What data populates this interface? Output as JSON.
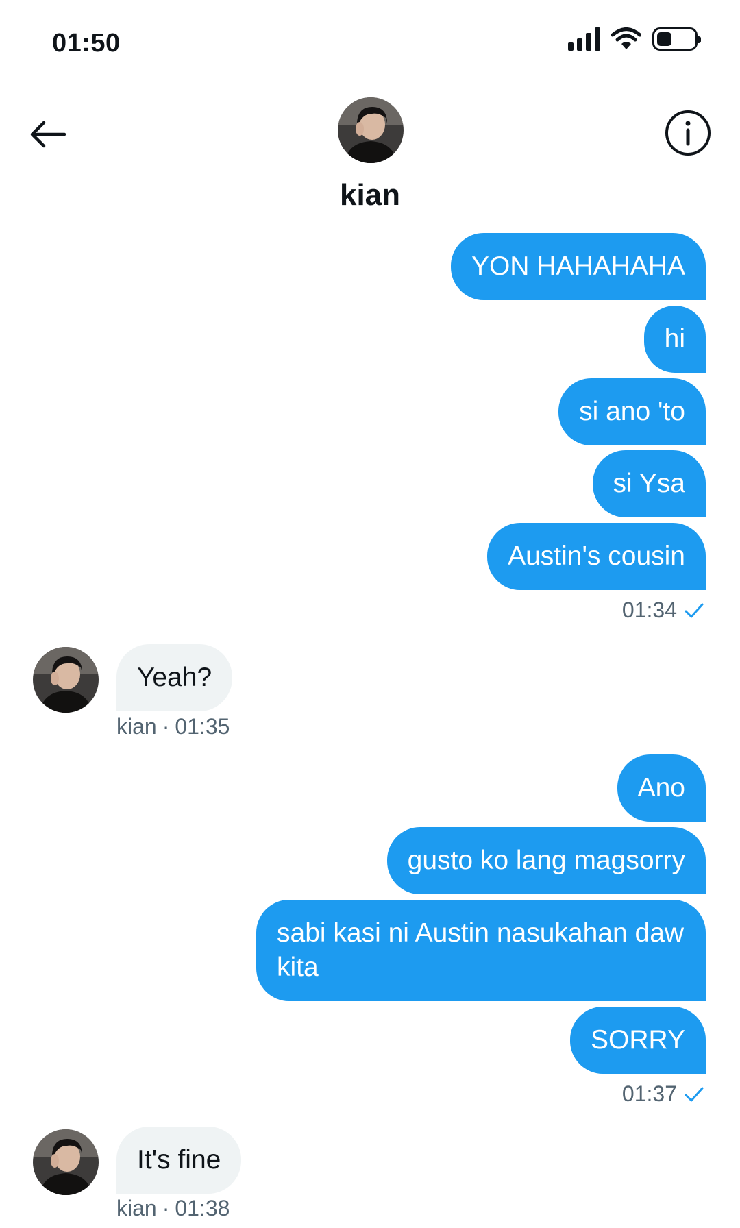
{
  "status_bar": {
    "time": "01:50",
    "icons": [
      "cellular-signal-icon",
      "wifi-icon",
      "battery-icon"
    ],
    "battery_level": 0.4
  },
  "header": {
    "back_icon": "arrow-left-icon",
    "info_icon": "info-circle-icon",
    "name": "kian"
  },
  "colors": {
    "accent": "#1d9bf0",
    "incoming_bubble": "#eff3f4",
    "meta_text": "#536471",
    "text": "#0f1419"
  },
  "messages": [
    {
      "direction": "out",
      "text": "YON HAHAHAHA"
    },
    {
      "direction": "out",
      "text": "hi"
    },
    {
      "direction": "out",
      "text": "si ano 'to"
    },
    {
      "direction": "out",
      "text": "si Ysa"
    },
    {
      "direction": "out",
      "text": "Austin's cousin"
    },
    {
      "direction": "out_meta",
      "time": "01:34",
      "status_icon": "check-icon"
    },
    {
      "direction": "in",
      "text": "Yeah?"
    },
    {
      "direction": "in_meta",
      "sender": "kian",
      "separator": "·",
      "time": "01:35"
    },
    {
      "direction": "out",
      "text": "Ano"
    },
    {
      "direction": "out",
      "text": "gusto ko lang magsorry"
    },
    {
      "direction": "out",
      "text": "sabi kasi ni Austin nasukahan daw kita"
    },
    {
      "direction": "out",
      "text": "SORRY"
    },
    {
      "direction": "out_meta",
      "time": "01:37",
      "status_icon": "check-icon"
    },
    {
      "direction": "in",
      "text": "It's fine"
    },
    {
      "direction": "in_meta",
      "sender": "kian",
      "separator": "·",
      "time": "01:38"
    }
  ]
}
